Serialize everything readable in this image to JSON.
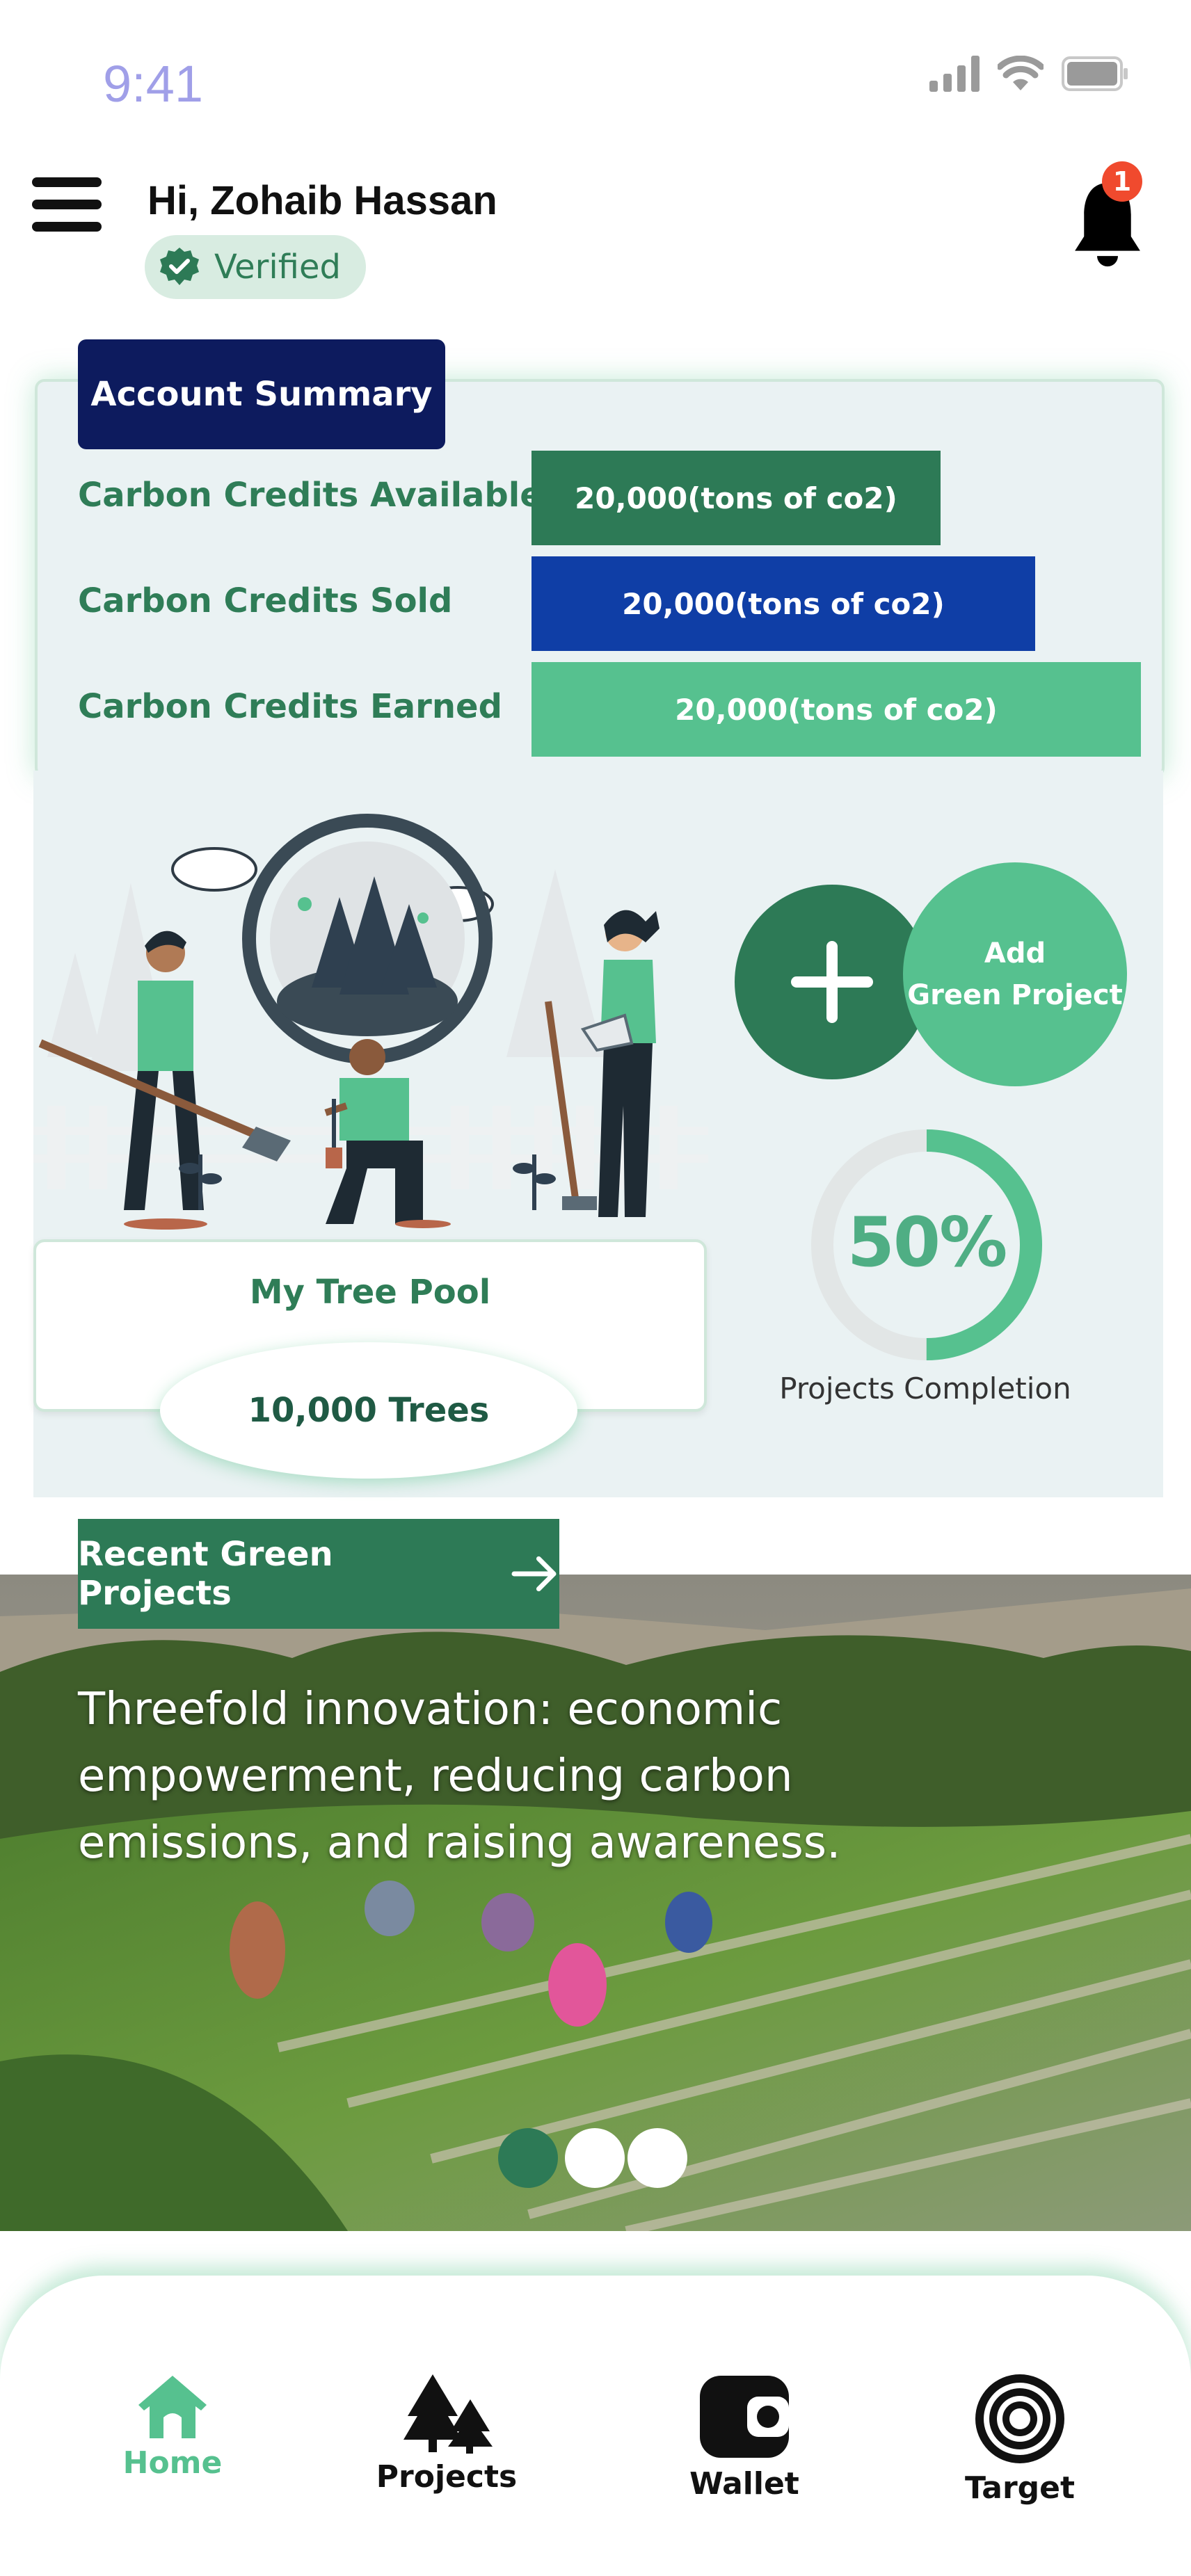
{
  "status_bar": {
    "time": "9:41"
  },
  "header": {
    "greeting": "Hi, Zohaib Hassan",
    "verified_label": "Verified",
    "notification_count": "1"
  },
  "account_summary": {
    "title": "Account Summary",
    "rows": [
      {
        "label": "Carbon Credits Available",
        "value": "20,000(tons of co2)",
        "color": "#2d7a56"
      },
      {
        "label": "Carbon Credits Sold",
        "value": "20,000(tons of co2)",
        "color": "#0f3ea6"
      },
      {
        "label": "Carbon Credits Earned",
        "value": "20,000(tons of co2)",
        "color": "#56c18f"
      }
    ]
  },
  "tree_pool": {
    "label": "My Tree Pool",
    "count": "10,000 Trees"
  },
  "add_project": {
    "label_line1": "Add",
    "label_line2": "Green Project"
  },
  "completion": {
    "value": "50%",
    "fraction": 0.5,
    "label": "Projects Completion"
  },
  "recent_projects": {
    "button_label": "Recent Green Projects",
    "slide_text": "Threefold innovation: economic empowerment, reducing carbon emissions, and raising awareness.",
    "slide_count": 3,
    "active_slide": 0
  },
  "bottom_nav": {
    "items": [
      {
        "label": "Home",
        "icon": "home-icon",
        "active": true
      },
      {
        "label": "Projects",
        "icon": "trees-icon",
        "active": false
      },
      {
        "label": "Wallet",
        "icon": "wallet-icon",
        "active": false
      },
      {
        "label": "Target",
        "icon": "target-icon",
        "active": false
      }
    ]
  },
  "colors": {
    "primary_green": "#2d7a56",
    "accent_green": "#56c18f",
    "navy": "#0d1b5e",
    "blue": "#0f3ea6",
    "panel_bg": "#eaf2f3"
  }
}
